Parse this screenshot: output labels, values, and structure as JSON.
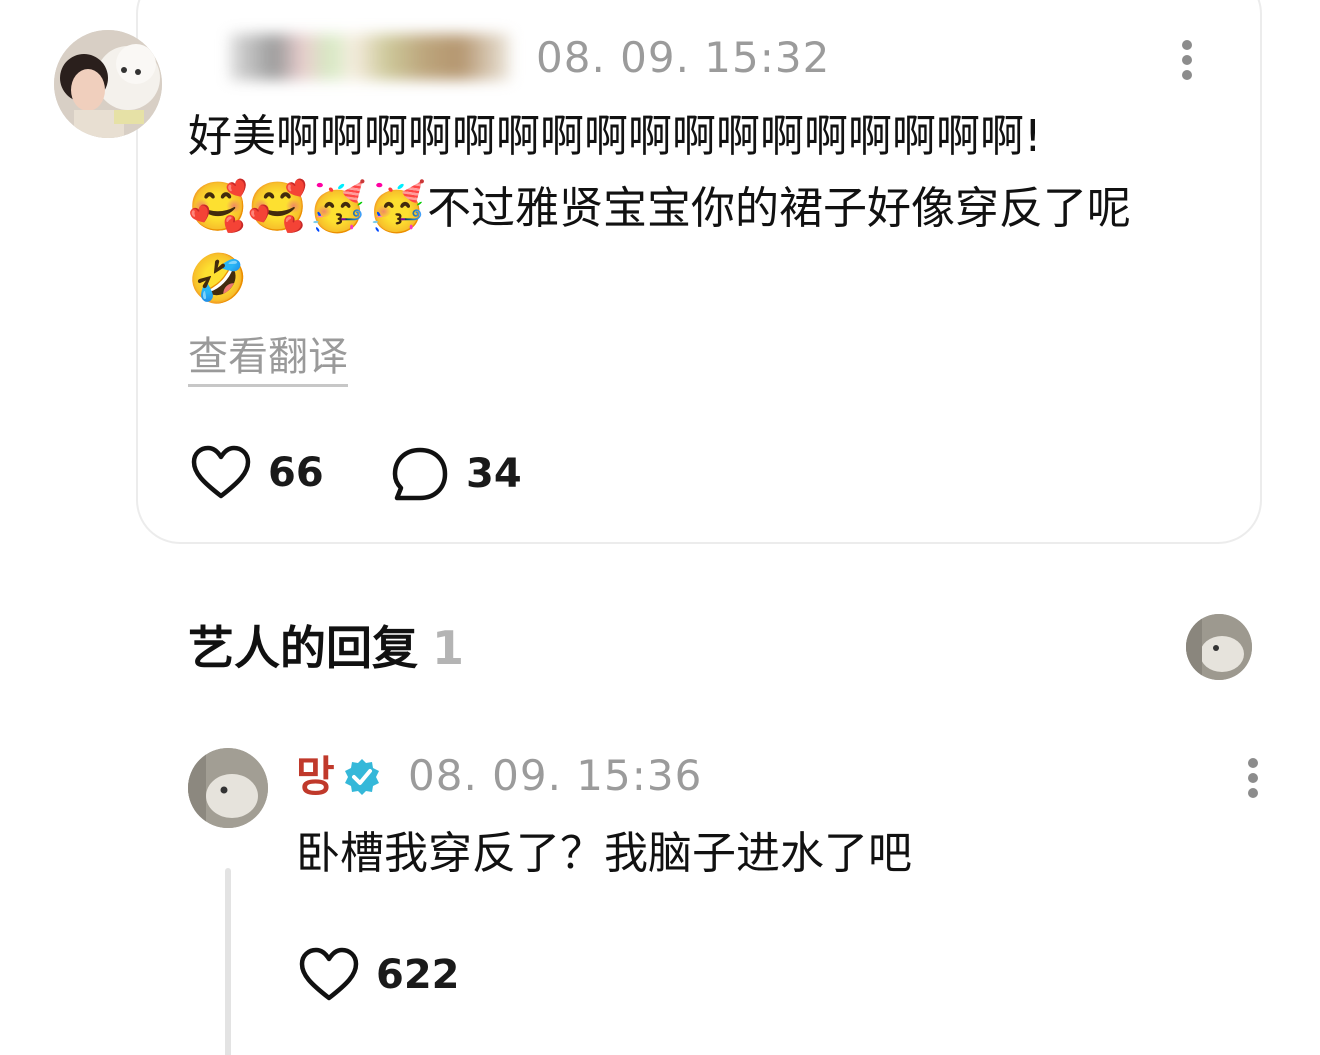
{
  "fan_comment": {
    "time": "08. 09. 15:32",
    "text_part1": "好美啊啊啊啊啊啊啊啊啊啊啊啊啊啊啊啊啊!",
    "emojis": "🥰🥰🥳🥳",
    "text_part2": "不过雅贤宝宝你的裙子好像穿反了呢",
    "emoji_end": "🤣",
    "translate_label": "查看翻译",
    "likes": "66",
    "replies": "34"
  },
  "artist_section": {
    "title": "艺人的回复",
    "count": "1"
  },
  "artist_reply": {
    "name": "망",
    "time": "08. 09. 15:36",
    "text": "卧槽我穿反了？我脑子进水了吧",
    "likes": "622"
  },
  "colors": {
    "verified_badge": "#35b8d9",
    "artist_name": "#c0392b",
    "muted_text": "#9b9b9b"
  },
  "icons": {
    "more": "more-vertical-icon",
    "like": "heart-icon",
    "reply": "comment-bubble-icon",
    "verified": "verified-badge-icon"
  }
}
